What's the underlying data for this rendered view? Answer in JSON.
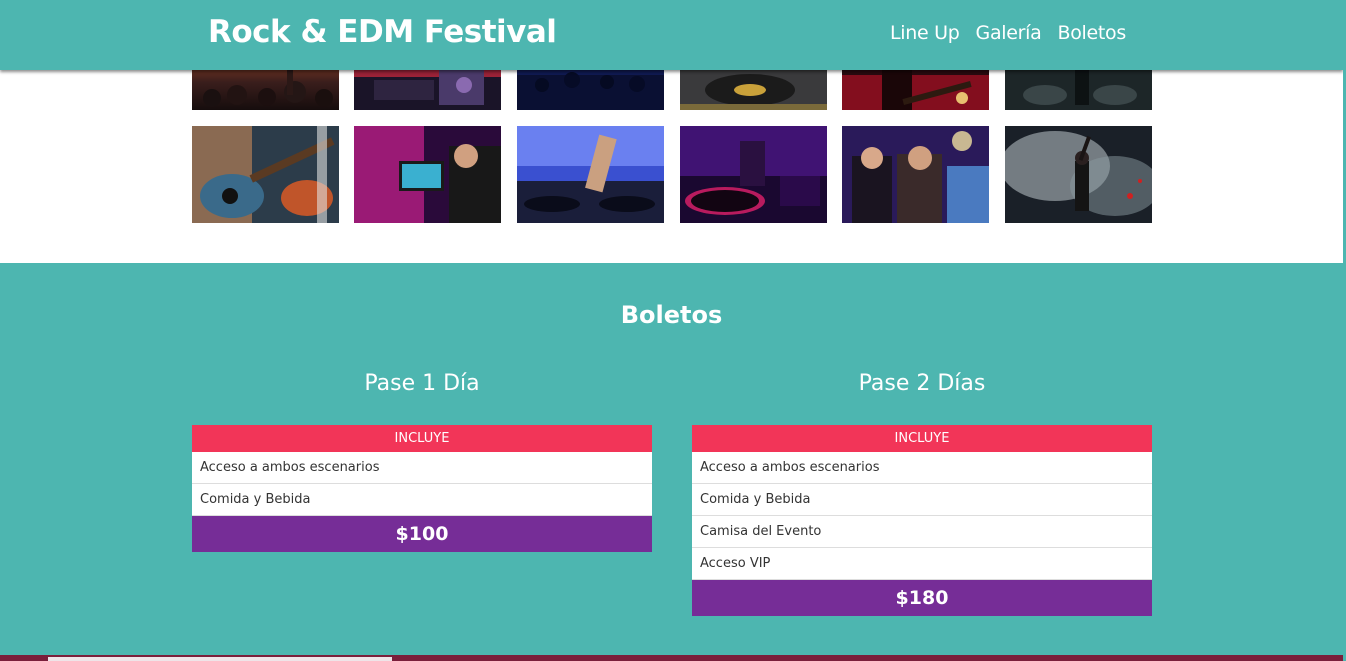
{
  "header": {
    "logo": "Rock & EDM Festival",
    "nav": [
      "Line Up",
      "Galería",
      "Boletos"
    ]
  },
  "gallery": {
    "rows": 2,
    "columns": 6,
    "items": [
      "crowd-concert-photo",
      "stage-equipment-photo",
      "crowd-blue-lights-photo",
      "dj-turntable-photo",
      "rock-guitarist-red-photo",
      "drummer-stage-photo",
      "guitarist-closeup-photo",
      "dj-laptop-neon-photo",
      "dj-mixer-blue-photo",
      "dj-turntable-purple-photo",
      "rock-singers-stage-photo",
      "performer-smoke-photo"
    ]
  },
  "tickets": {
    "title": "Boletos",
    "plans": [
      {
        "name": "Pase 1 Día",
        "header": "INCLUYE",
        "features": [
          "Acceso a ambos escenarios",
          "Comida y Bebida"
        ],
        "price": "$100"
      },
      {
        "name": "Pase 2 Días",
        "header": "INCLUYE",
        "features": [
          "Acceso a ambos escenarios",
          "Comida y Bebida",
          "Camisa del Evento",
          "Acceso VIP"
        ],
        "price": "$180"
      }
    ]
  },
  "colors": {
    "teal": "#4db6b0",
    "pink": "#f23558",
    "purple": "#762d97",
    "white": "#ffffff"
  }
}
